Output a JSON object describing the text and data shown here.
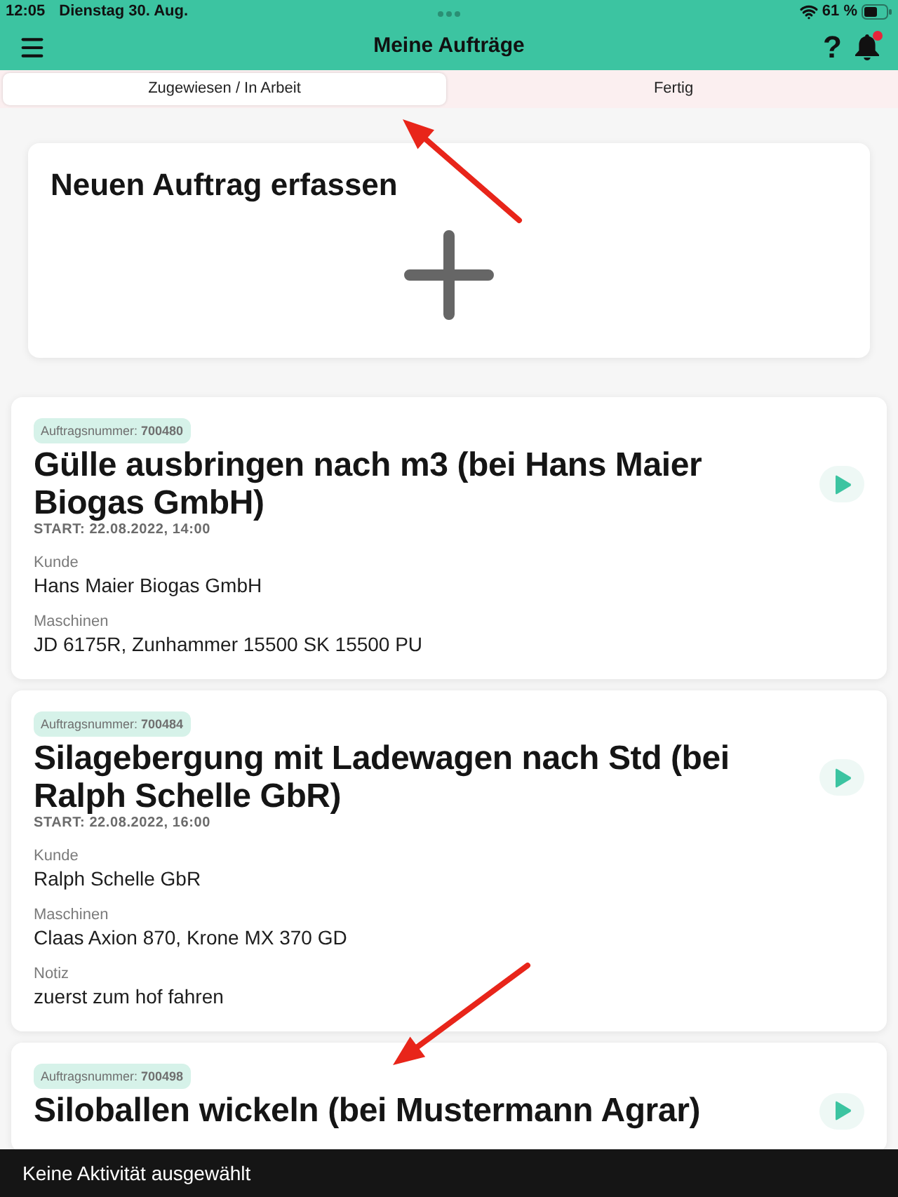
{
  "status_bar": {
    "time": "12:05",
    "date": "Dienstag 30. Aug.",
    "battery": "61 %"
  },
  "header": {
    "title": "Meine Aufträge",
    "help_label": "?",
    "has_notification": true
  },
  "tabs": [
    {
      "label": "Zugewiesen / In Arbeit",
      "selected": true
    },
    {
      "label": "Fertig",
      "selected": false
    }
  ],
  "new_order_card": {
    "title": "Neuen Auftrag erfassen"
  },
  "orders": [
    {
      "badge": "Auftragsnummer: **700480**",
      "title": "Gülle ausbringen nach m3 (bei Hans Maier Biogas GmbH)",
      "start": "START: 22.08.2022, 14:00",
      "fields": [
        {
          "label": "Kunde",
          "value": "Hans Maier Biogas GmbH"
        },
        {
          "label": "Maschinen",
          "value": "JD 6175R, Zunhammer 15500 SK 15500 PU"
        }
      ]
    },
    {
      "badge": "Auftragsnummer: **700484**",
      "title": "Silagebergung mit Ladewagen nach Std (bei Ralph Schelle GbR)",
      "start": "START: 22.08.2022, 16:00",
      "fields": [
        {
          "label": "Kunde",
          "value": "Ralph Schelle GbR"
        },
        {
          "label": "Maschinen",
          "value": "Claas Axion 870, Krone MX 370 GD"
        },
        {
          "label": "Notiz",
          "value": "zuerst zum hof fahren"
        }
      ]
    },
    {
      "badge": "Auftragsnummer: **700498**",
      "title": "Siloballen wickeln (bei Mustermann Agrar)"
    }
  ],
  "activity_bar": {
    "text": "Keine Aktivität ausgewählt"
  }
}
